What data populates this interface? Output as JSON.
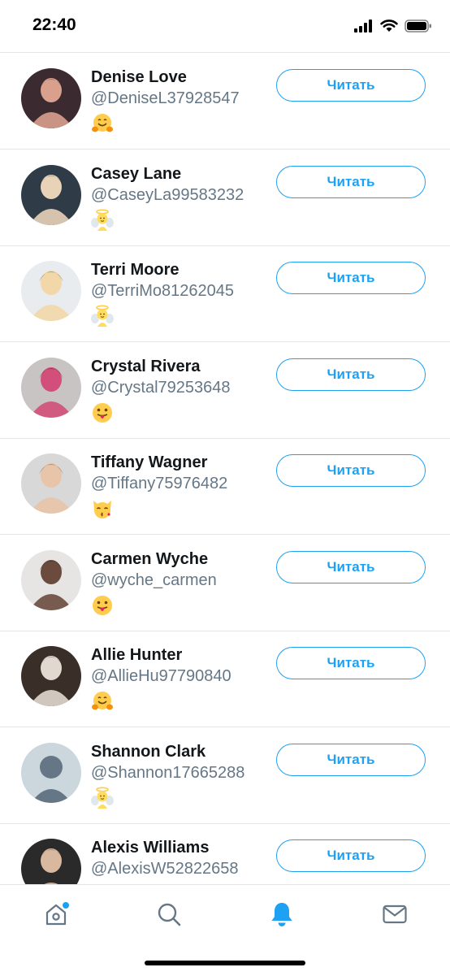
{
  "status": {
    "time": "22:40"
  },
  "follow_label": "Читать",
  "users": [
    {
      "name": "Denise Love",
      "handle": "@DeniseL37928547",
      "emoji": "hugging-face-emoji",
      "avatar_bg": "#3b2a2f",
      "avatar_fg": "#d9a08d"
    },
    {
      "name": "Casey Lane",
      "handle": "@CaseyLa99583232",
      "emoji": "baby-angel-emoji",
      "avatar_bg": "#2f3b47",
      "avatar_fg": "#e8d3b8"
    },
    {
      "name": "Terri Moore",
      "handle": "@TerriMo81262045",
      "emoji": "baby-angel-emoji",
      "avatar_bg": "#e9ecef",
      "avatar_fg": "#f2d7a9"
    },
    {
      "name": "Crystal Rivera",
      "handle": "@Crystal79253648",
      "emoji": "tongue-out-emoji",
      "avatar_bg": "#c9c4c4",
      "avatar_fg": "#d14f7a"
    },
    {
      "name": "Tiffany Wagner",
      "handle": "@Tiffany75976482",
      "emoji": "kissing-cat-emoji",
      "avatar_bg": "#d8d8d8",
      "avatar_fg": "#e8c5a8"
    },
    {
      "name": "Carmen Wyche",
      "handle": "@wyche_carmen",
      "emoji": "tongue-out-emoji",
      "avatar_bg": "#e7e5e4",
      "avatar_fg": "#6b4b3e"
    },
    {
      "name": "Allie Hunter",
      "handle": "@AllieHu97790840",
      "emoji": "hugging-face-emoji",
      "avatar_bg": "#3a2e28",
      "avatar_fg": "#e1d8cf"
    },
    {
      "name": "Shannon Clark",
      "handle": "@Shannon17665288",
      "emoji": "baby-angel-emoji",
      "avatar_bg": "#ccd6dd",
      "avatar_fg": "#657786",
      "default_avatar": true
    },
    {
      "name": "Alexis Williams",
      "handle": "@AlexisW52822658",
      "emoji": "",
      "avatar_bg": "#2a2a2a",
      "avatar_fg": "#d8b9a0"
    }
  ],
  "tabs": [
    {
      "name": "home",
      "icon": "home-icon",
      "active": false,
      "badge": true
    },
    {
      "name": "search",
      "icon": "search-icon",
      "active": false
    },
    {
      "name": "notifications",
      "icon": "bell-icon",
      "active": true
    },
    {
      "name": "messages",
      "icon": "mail-icon",
      "active": false
    }
  ],
  "colors": {
    "accent": "#1da1f2",
    "text": "#14171a",
    "secondary": "#657786"
  }
}
